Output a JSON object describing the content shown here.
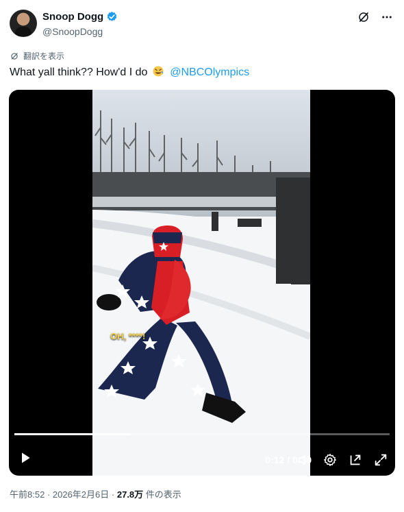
{
  "author": {
    "display_name": "Snoop Dogg",
    "handle": "@SnoopDogg"
  },
  "translate_label": "翻訳を表示",
  "tweet": {
    "text_before": "What yall think?? How'd I do",
    "emoji": "rolling-on-floor-laughing",
    "mention": "@NBCOlympics"
  },
  "video": {
    "caption": "OH, ****!",
    "current_time": "0:12",
    "duration": "0:39",
    "time_label": "0:12 / 0:39",
    "progress": 0.31
  },
  "footer": {
    "time": "午前8:52",
    "date": "2026年2月6日",
    "views_count": "27.8万",
    "views_label": "件の表示"
  },
  "colors": {
    "verified": "#1d9bf0",
    "mention": "#1d9bf0"
  }
}
